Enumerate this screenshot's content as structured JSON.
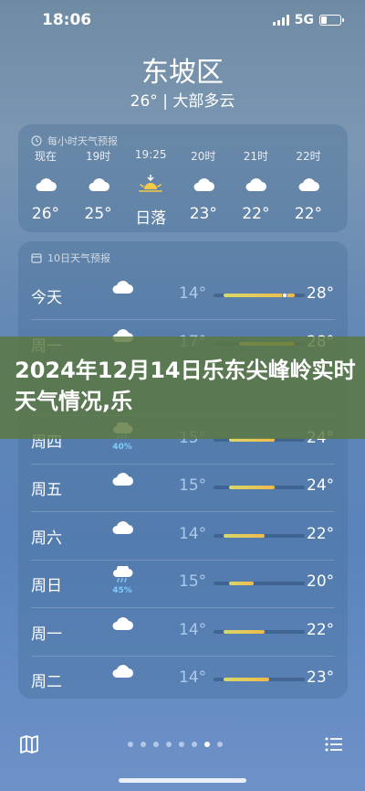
{
  "status": {
    "time": "18:06",
    "network": "5G",
    "battery_percent": 30
  },
  "header": {
    "location": "东坡区",
    "current_summary": "26° | 大部多云"
  },
  "hourly": {
    "title": "每小时天气预报",
    "items": [
      {
        "time": "现在",
        "icon": "cloud-icon",
        "temp": "26°"
      },
      {
        "time": "19时",
        "icon": "cloud-icon",
        "temp": "25°"
      },
      {
        "time": "19:25",
        "icon": "sunset-icon",
        "temp": "日落"
      },
      {
        "time": "20时",
        "icon": "cloud-icon",
        "temp": "23°"
      },
      {
        "time": "21时",
        "icon": "cloud-icon",
        "temp": "22°"
      },
      {
        "time": "22时",
        "icon": "cloud-icon",
        "temp": "22°"
      }
    ]
  },
  "daily": {
    "title": "10日天气预报",
    "range_min": 12,
    "range_max": 30,
    "items": [
      {
        "day": "今天",
        "icon": "cloud-icon",
        "precip": "",
        "low": "14°",
        "high": "28°",
        "low_value": 14,
        "high_value": 28,
        "now_value": 26
      },
      {
        "day": "周一",
        "icon": "cloud-icon",
        "precip": "",
        "low": "17°",
        "high": "28°",
        "low_value": 17,
        "high_value": 28
      },
      {
        "day": "",
        "icon": "",
        "precip": "",
        "low": "",
        "high": "",
        "low_value": 0,
        "high_value": 0
      },
      {
        "day": "周四",
        "icon": "rain-cloud-icon",
        "precip": "40%",
        "low": "15°",
        "high": "24°",
        "low_value": 15,
        "high_value": 24
      },
      {
        "day": "周五",
        "icon": "cloud-icon",
        "precip": "",
        "low": "15°",
        "high": "24°",
        "low_value": 15,
        "high_value": 24
      },
      {
        "day": "周六",
        "icon": "cloud-icon",
        "precip": "",
        "low": "14°",
        "high": "22°",
        "low_value": 14,
        "high_value": 22
      },
      {
        "day": "周日",
        "icon": "rain-cloud-icon",
        "precip": "45%",
        "low": "15°",
        "high": "20°",
        "low_value": 15,
        "high_value": 20
      },
      {
        "day": "周一",
        "icon": "cloud-icon",
        "precip": "",
        "low": "14°",
        "high": "22°",
        "low_value": 14,
        "high_value": 22
      },
      {
        "day": "周二",
        "icon": "cloud-icon",
        "precip": "",
        "low": "14°",
        "high": "23°",
        "low_value": 14,
        "high_value": 23
      }
    ]
  },
  "banner": {
    "text": "2024年12月14日乐东尖峰岭实时天气情况,乐"
  },
  "bottom": {
    "page_count": 8,
    "active_page": 6,
    "map_icon": "map-icon",
    "list_icon": "list-icon"
  },
  "colors": {
    "bar_start": "#d7d96a",
    "bar_end": "#f0b94a",
    "precip": "#7ecbff",
    "banner": "#5c783e"
  }
}
